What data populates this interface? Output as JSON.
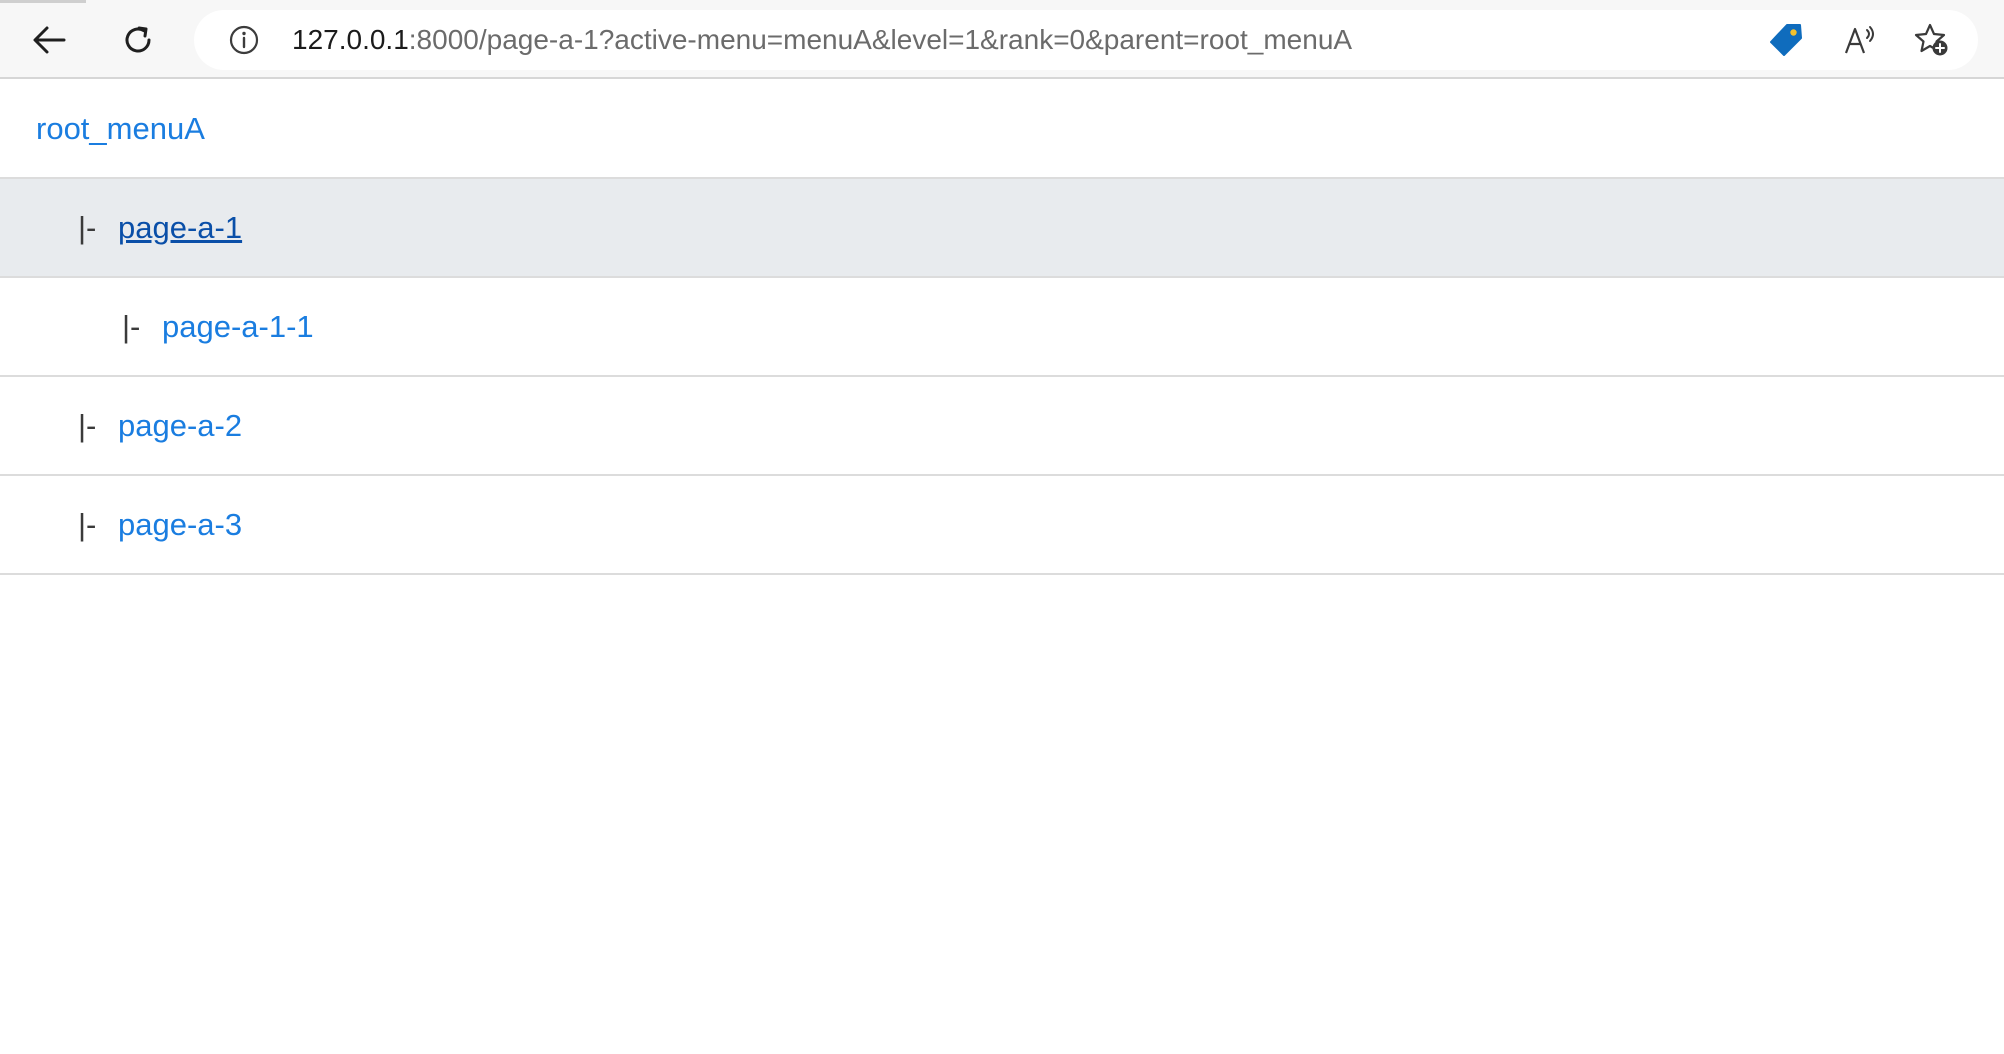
{
  "browser": {
    "url_host": "127.0.0.1",
    "url_rest": ":8000/page-a-1?active-menu=menuA&level=1&rank=0&parent=root_menuA",
    "icons": [
      "back-arrow-icon",
      "reload-icon",
      "info-icon",
      "shopping-tag-icon",
      "read-aloud-icon",
      "add-favorite-icon"
    ],
    "accent_color": "#0f6cbd"
  },
  "menu": {
    "root": {
      "label": "root_menuA"
    },
    "items": [
      {
        "prefix": "|-",
        "label": "page-a-1",
        "level": 1,
        "active": true
      },
      {
        "prefix": "|-",
        "label": "page-a-1-1",
        "level": 2,
        "active": false
      },
      {
        "prefix": "|-",
        "label": "page-a-2",
        "level": 1,
        "active": false
      },
      {
        "prefix": "|-",
        "label": "page-a-3",
        "level": 1,
        "active": false
      }
    ],
    "link_color": "#1a7de0",
    "active_bg": "#e8ebee"
  }
}
